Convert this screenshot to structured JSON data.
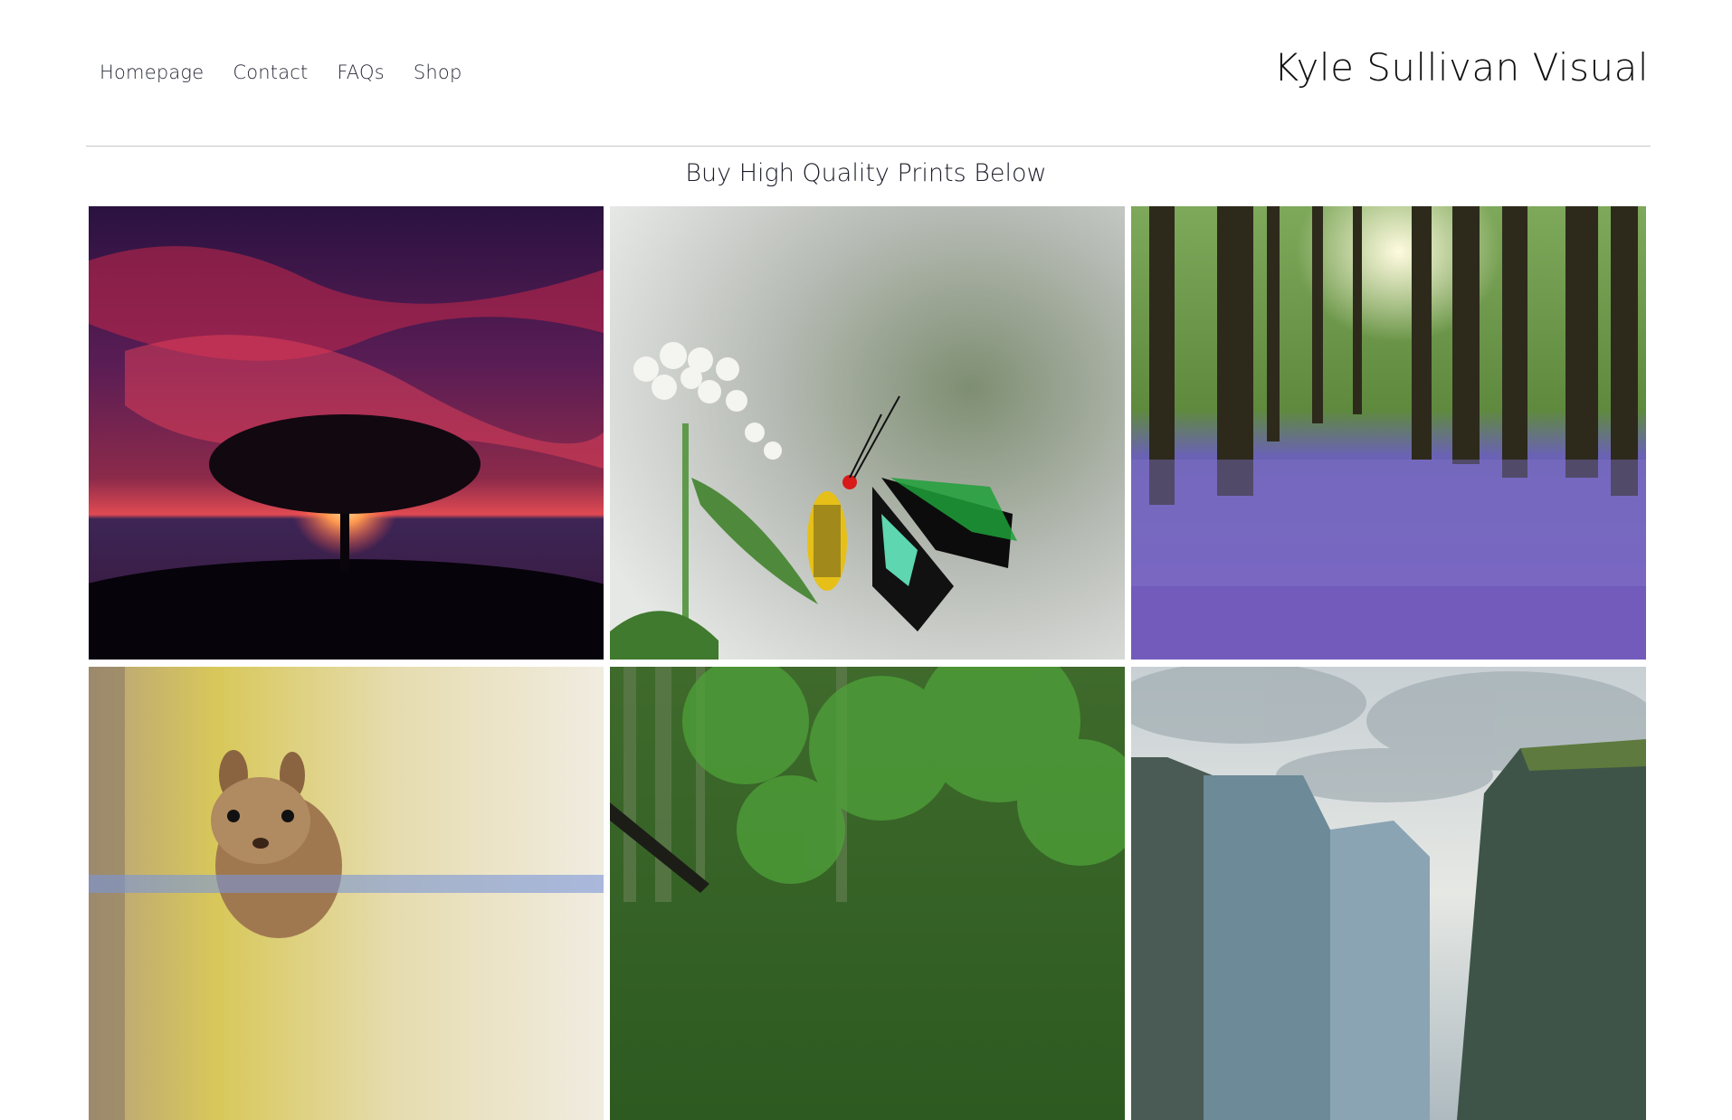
{
  "nav": {
    "items": [
      {
        "label": "Homepage"
      },
      {
        "label": "Contact"
      },
      {
        "label": "FAQs"
      },
      {
        "label": "Shop"
      }
    ]
  },
  "brand": {
    "title": "Kyle Sullivan Visual"
  },
  "main": {
    "heading": "Buy High Quality Prints Below"
  },
  "gallery": {
    "tiles": [
      {
        "icon": "sunset-tree-photo"
      },
      {
        "icon": "butterfly-flower-photo"
      },
      {
        "icon": "bluebell-forest-photo"
      },
      {
        "icon": "chipmunk-photo"
      },
      {
        "icon": "green-forest-photo"
      },
      {
        "icon": "fjord-cliffs-photo"
      }
    ]
  }
}
